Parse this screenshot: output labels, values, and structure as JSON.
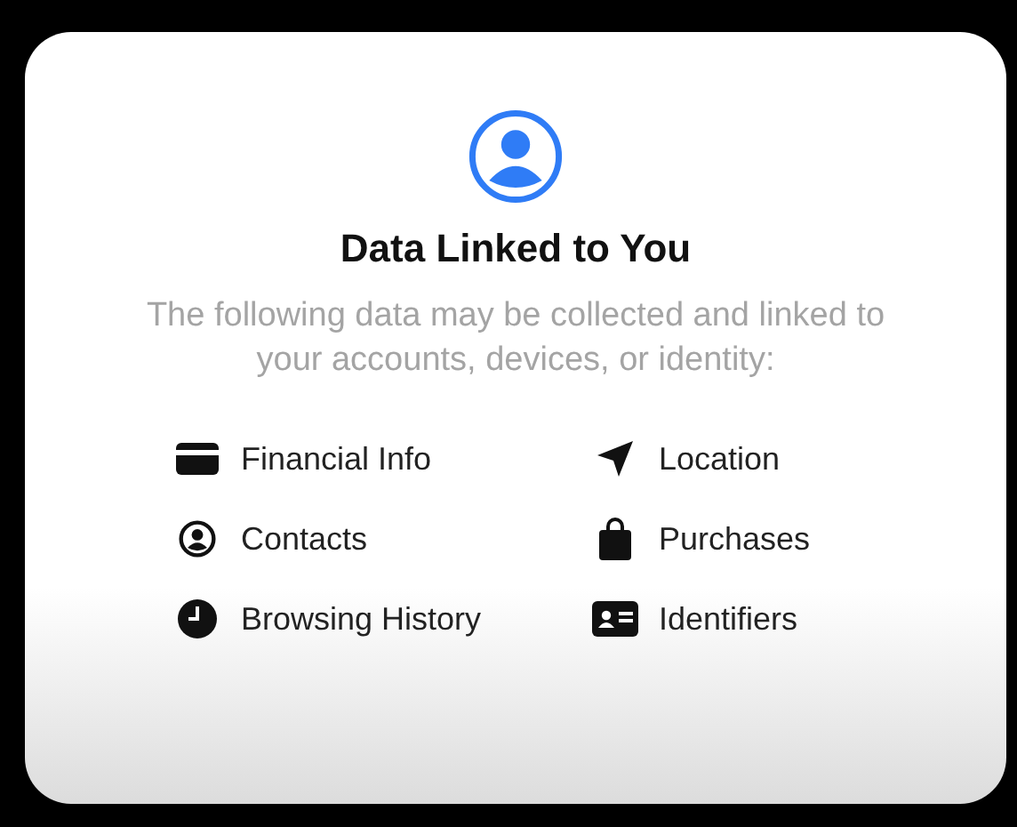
{
  "card": {
    "title": "Data Linked to You",
    "description": "The following data may be collected and linked to your accounts, devices, or identity:",
    "items": [
      {
        "kind": "card",
        "label": "Financial Info"
      },
      {
        "kind": "location",
        "label": "Location"
      },
      {
        "kind": "contacts",
        "label": "Contacts"
      },
      {
        "kind": "bag",
        "label": "Purchases"
      },
      {
        "kind": "clock",
        "label": "Browsing History"
      },
      {
        "kind": "id",
        "label": "Identifiers"
      }
    ]
  }
}
